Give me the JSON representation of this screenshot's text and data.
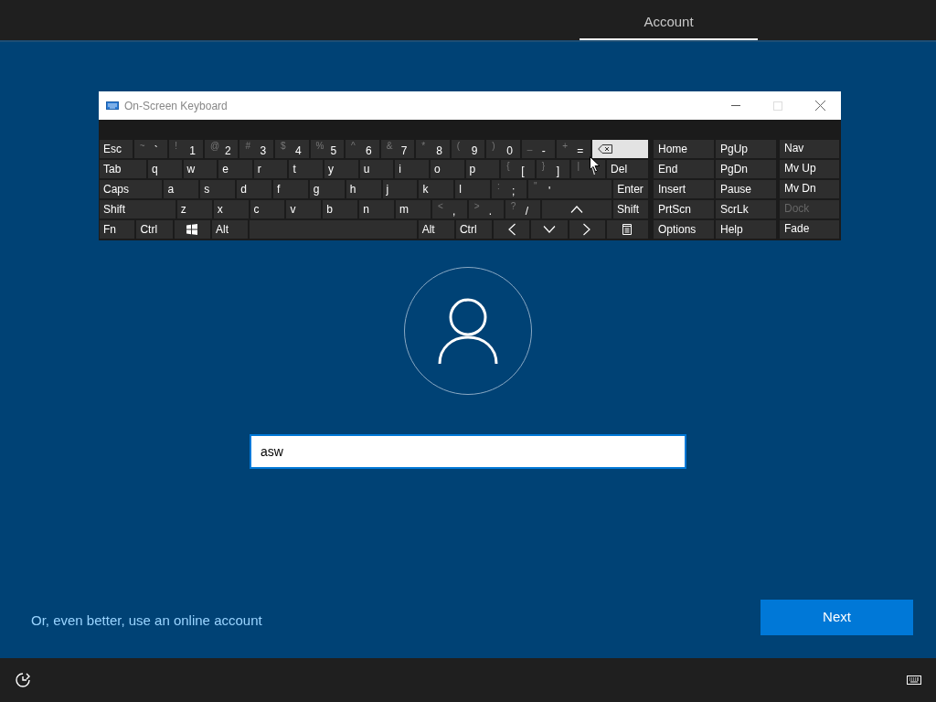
{
  "tabs": [
    {
      "label": "Account",
      "selected": true
    }
  ],
  "keyboard": {
    "title": "On-Screen Keyboard",
    "key_rows": [
      {
        "keys": [
          {
            "label": "Esc",
            "kind": "text",
            "highlighted": false
          },
          {
            "shift": "~",
            "label": "`",
            "kind": "text",
            "highlighted": false
          },
          {
            "shift": "!",
            "label": "1",
            "kind": "text",
            "highlighted": false
          },
          {
            "shift": "@",
            "label": "2",
            "kind": "text",
            "highlighted": false
          },
          {
            "shift": "#",
            "label": "3",
            "kind": "text",
            "highlighted": false
          },
          {
            "shift": "$",
            "label": "4",
            "kind": "text",
            "highlighted": false
          },
          {
            "shift": "%",
            "label": "5",
            "kind": "text",
            "highlighted": false
          },
          {
            "shift": "^",
            "label": "6",
            "kind": "text",
            "highlighted": false
          },
          {
            "shift": "&",
            "label": "7",
            "kind": "text",
            "highlighted": false
          },
          {
            "shift": "*",
            "label": "8",
            "kind": "text",
            "highlighted": false
          },
          {
            "shift": "(",
            "label": "9",
            "kind": "text",
            "highlighted": false
          },
          {
            "shift": ")",
            "label": "0",
            "kind": "text",
            "highlighted": false
          },
          {
            "shift": "_",
            "label": "-",
            "kind": "text",
            "highlighted": false
          },
          {
            "shift": "+",
            "label": "=",
            "kind": "text",
            "highlighted": false
          },
          {
            "kind": "backspace",
            "highlighted": true
          }
        ]
      },
      {
        "keys": [
          {
            "label": "Tab",
            "kind": "text",
            "highlighted": false
          },
          {
            "label": "q",
            "kind": "text",
            "highlighted": false
          },
          {
            "label": "w",
            "kind": "text",
            "highlighted": false
          },
          {
            "label": "e",
            "kind": "text",
            "highlighted": false
          },
          {
            "label": "r",
            "kind": "text",
            "highlighted": false
          },
          {
            "label": "t",
            "kind": "text",
            "highlighted": false
          },
          {
            "label": "y",
            "kind": "text",
            "highlighted": false
          },
          {
            "label": "u",
            "kind": "text",
            "highlighted": false
          },
          {
            "label": "i",
            "kind": "text",
            "highlighted": false
          },
          {
            "label": "o",
            "kind": "text",
            "highlighted": false
          },
          {
            "label": "p",
            "kind": "text",
            "highlighted": false
          },
          {
            "shift": "{",
            "label": "[",
            "kind": "text",
            "highlighted": false
          },
          {
            "shift": "}",
            "label": "]",
            "kind": "text",
            "highlighted": false
          },
          {
            "shift": "|",
            "label": "\\",
            "kind": "text",
            "highlighted": false
          },
          {
            "label": "Del",
            "kind": "text",
            "highlighted": false
          }
        ]
      },
      {
        "keys": [
          {
            "label": "Caps",
            "kind": "text",
            "highlighted": false
          },
          {
            "label": "a",
            "kind": "text",
            "highlighted": false
          },
          {
            "label": "s",
            "kind": "text",
            "highlighted": false
          },
          {
            "label": "d",
            "kind": "text",
            "highlighted": false
          },
          {
            "label": "f",
            "kind": "text",
            "highlighted": false
          },
          {
            "label": "g",
            "kind": "text",
            "highlighted": false
          },
          {
            "label": "h",
            "kind": "text",
            "highlighted": false
          },
          {
            "label": "j",
            "kind": "text",
            "highlighted": false
          },
          {
            "label": "k",
            "kind": "text",
            "highlighted": false
          },
          {
            "label": "l",
            "kind": "text",
            "highlighted": false
          },
          {
            "shift": ":",
            "label": ";",
            "kind": "text",
            "highlighted": false
          },
          {
            "shift": "\"",
            "label": "'",
            "kind": "text",
            "highlighted": false
          },
          {
            "label": "Enter",
            "kind": "text",
            "highlighted": false
          }
        ]
      },
      {
        "keys": [
          {
            "label": "Shift",
            "kind": "text",
            "highlighted": false
          },
          {
            "label": "z",
            "kind": "text",
            "highlighted": false
          },
          {
            "label": "x",
            "kind": "text",
            "highlighted": false
          },
          {
            "label": "c",
            "kind": "text",
            "highlighted": false
          },
          {
            "label": "v",
            "kind": "text",
            "highlighted": false
          },
          {
            "label": "b",
            "kind": "text",
            "highlighted": false
          },
          {
            "label": "n",
            "kind": "text",
            "highlighted": false
          },
          {
            "label": "m",
            "kind": "text",
            "highlighted": false
          },
          {
            "shift": "<",
            "label": ",",
            "kind": "text",
            "highlighted": false
          },
          {
            "shift": ">",
            "label": ".",
            "kind": "text",
            "highlighted": false
          },
          {
            "shift": "?",
            "label": "/",
            "kind": "text",
            "highlighted": false
          },
          {
            "kind": "up",
            "highlighted": false
          },
          {
            "label": "Shift",
            "kind": "text",
            "highlighted": false
          }
        ]
      },
      {
        "keys": [
          {
            "label": "Fn",
            "kind": "text",
            "highlighted": false
          },
          {
            "label": "Ctrl",
            "kind": "text",
            "highlighted": false
          },
          {
            "kind": "windows",
            "highlighted": false
          },
          {
            "label": "Alt",
            "kind": "text",
            "highlighted": false
          },
          {
            "kind": "space",
            "highlighted": false
          },
          {
            "label": "Alt",
            "kind": "text",
            "highlighted": false
          },
          {
            "label": "Ctrl",
            "kind": "text",
            "highlighted": false
          },
          {
            "kind": "left",
            "highlighted": false
          },
          {
            "kind": "down",
            "highlighted": false
          },
          {
            "kind": "right",
            "highlighted": false
          },
          {
            "kind": "menu",
            "highlighted": false
          }
        ]
      }
    ],
    "side_rows": [
      [
        {
          "label": "Home",
          "disabled": false
        },
        {
          "label": "PgUp",
          "disabled": false
        },
        {
          "label": "Nav",
          "disabled": false
        }
      ],
      [
        {
          "label": "End",
          "disabled": false
        },
        {
          "label": "PgDn",
          "disabled": false
        },
        {
          "label": "Mv Up",
          "disabled": false
        }
      ],
      [
        {
          "label": "Insert",
          "disabled": false
        },
        {
          "label": "Pause",
          "disabled": false
        },
        {
          "label": "Mv Dn",
          "disabled": false
        }
      ],
      [
        {
          "label": "PrtScn",
          "disabled": false
        },
        {
          "label": "ScrLk",
          "disabled": false
        },
        {
          "label": "Dock",
          "disabled": true
        }
      ],
      [
        {
          "label": "Options",
          "disabled": false
        },
        {
          "label": "Help",
          "disabled": false
        },
        {
          "label": "Fade",
          "disabled": false
        }
      ]
    ]
  },
  "username": {
    "value": "asw"
  },
  "online_account_link": "Or, even better, use an online account",
  "next_button": "Next"
}
